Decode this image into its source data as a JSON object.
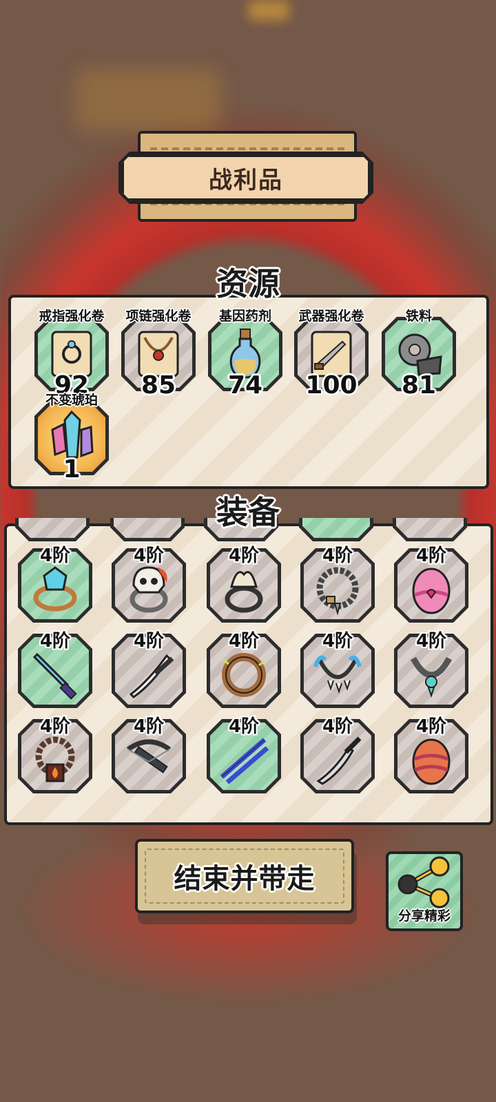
{
  "header": {
    "title": "战利品"
  },
  "sections": {
    "resources_title": "资源",
    "equipment_title": "装备"
  },
  "resources": [
    {
      "label": "戒指强化卷",
      "count": "92",
      "icon": "ring-scroll-icon",
      "bg": "green"
    },
    {
      "label": "项链强化卷",
      "count": "85",
      "icon": "necklace-scroll-icon",
      "bg": "grey"
    },
    {
      "label": "基因药剂",
      "count": "74",
      "icon": "potion-icon",
      "bg": "green"
    },
    {
      "label": "武器强化卷",
      "count": "100",
      "icon": "weapon-scroll-icon",
      "bg": "grey"
    },
    {
      "label": "铁料",
      "count": "81",
      "icon": "iron-gear-icon",
      "bg": "green"
    },
    {
      "label": "不变琥珀",
      "count": "1",
      "icon": "amber-crystal-icon",
      "bg": "gold"
    }
  ],
  "equipment": [
    {
      "tier": "4阶",
      "icon": "gem-ring-icon",
      "bg": "green"
    },
    {
      "tier": "4阶",
      "icon": "skull-ring-icon",
      "bg": "grey"
    },
    {
      "tier": "4阶",
      "icon": "bone-ring-icon",
      "bg": "grey"
    },
    {
      "tier": "4阶",
      "icon": "bead-necklace-icon",
      "bg": "grey"
    },
    {
      "tier": "4阶",
      "icon": "pink-egg-icon",
      "bg": "grey"
    },
    {
      "tier": "4阶",
      "icon": "blue-sword-icon",
      "bg": "green"
    },
    {
      "tier": "4阶",
      "icon": "katana-icon",
      "bg": "grey"
    },
    {
      "tier": "4阶",
      "icon": "wooden-ring-icon",
      "bg": "grey"
    },
    {
      "tier": "4阶",
      "icon": "tooth-necklace-icon",
      "bg": "grey"
    },
    {
      "tier": "4阶",
      "icon": "jade-necklace-icon",
      "bg": "grey"
    },
    {
      "tier": "4阶",
      "icon": "fire-necklace-icon",
      "bg": "grey"
    },
    {
      "tier": "4阶",
      "icon": "crossbow-icon",
      "bg": "grey"
    },
    {
      "tier": "4阶",
      "icon": "twin-katana-icon",
      "bg": "green"
    },
    {
      "tier": "4阶",
      "icon": "short-blade-icon",
      "bg": "grey"
    },
    {
      "tier": "4阶",
      "icon": "red-egg-icon",
      "bg": "grey"
    }
  ],
  "buttons": {
    "end_label": "结束并带走",
    "share_label": "分享精彩"
  },
  "colors": {
    "green_tile": "#a9dcbb",
    "grey_tile": "#d9d0cc",
    "panel": "#f4eadb",
    "button": "#d8c596"
  }
}
